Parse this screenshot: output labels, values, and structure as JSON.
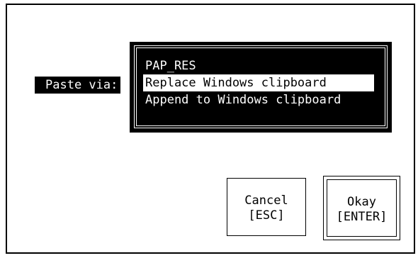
{
  "dialog": {
    "paste_label": "Paste via:",
    "options": [
      "PAP_RES",
      "Replace Windows clipboard",
      "Append to Windows clipboard"
    ],
    "selected_option": "Replace Windows clipboard"
  },
  "buttons": {
    "cancel_label": "Cancel",
    "cancel_key": "[ESC]",
    "okay_label": "Okay",
    "okay_key": "[ENTER]"
  }
}
